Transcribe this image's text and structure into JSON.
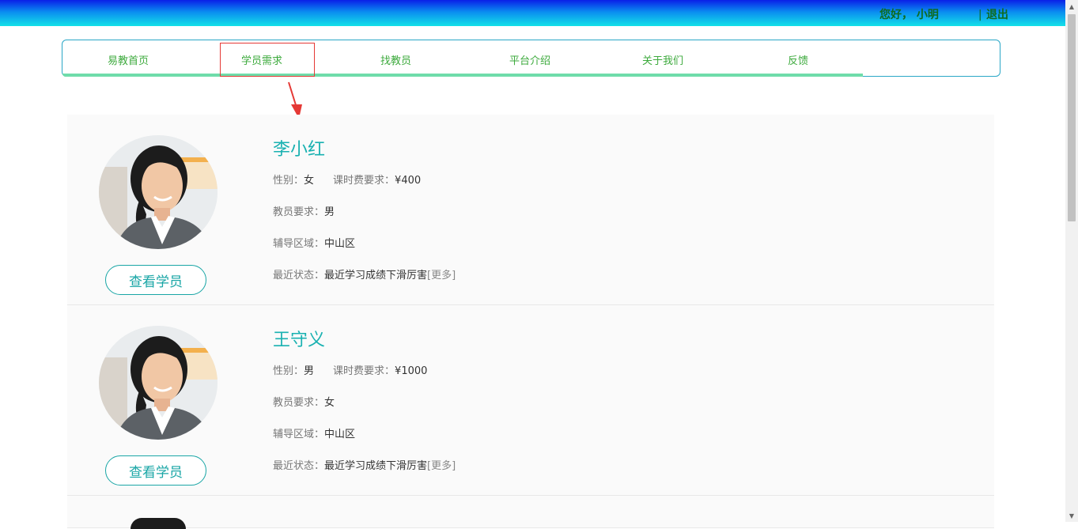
{
  "header": {
    "greeting": "您好， 小明",
    "separator": "|",
    "logout_label": "退出"
  },
  "nav": {
    "items": [
      {
        "label": "易教首页"
      },
      {
        "label": "学员需求"
      },
      {
        "label": "找教员"
      },
      {
        "label": "平台介绍"
      },
      {
        "label": "关于我们"
      },
      {
        "label": "反馈"
      }
    ]
  },
  "labels": {
    "gender": "性别：",
    "fee": "课时费要求：",
    "teacher_req": "教员要求：",
    "area": "辅导区域：",
    "status": "最近状态：",
    "more": "[更多]",
    "view_button": "查看学员"
  },
  "students": [
    {
      "name": "李小红",
      "gender": "女",
      "fee": "¥400",
      "teacher_req": "男",
      "area": "中山区",
      "status": "最近学习成绩下滑厉害"
    },
    {
      "name": "王守义",
      "gender": "男",
      "fee": "¥1000",
      "teacher_req": "女",
      "area": "中山区",
      "status": "最近学习成绩下滑厉害"
    }
  ],
  "colors": {
    "accent": "#19b1b1",
    "nav_text": "#3daa3d",
    "highlight": "#e53935"
  }
}
